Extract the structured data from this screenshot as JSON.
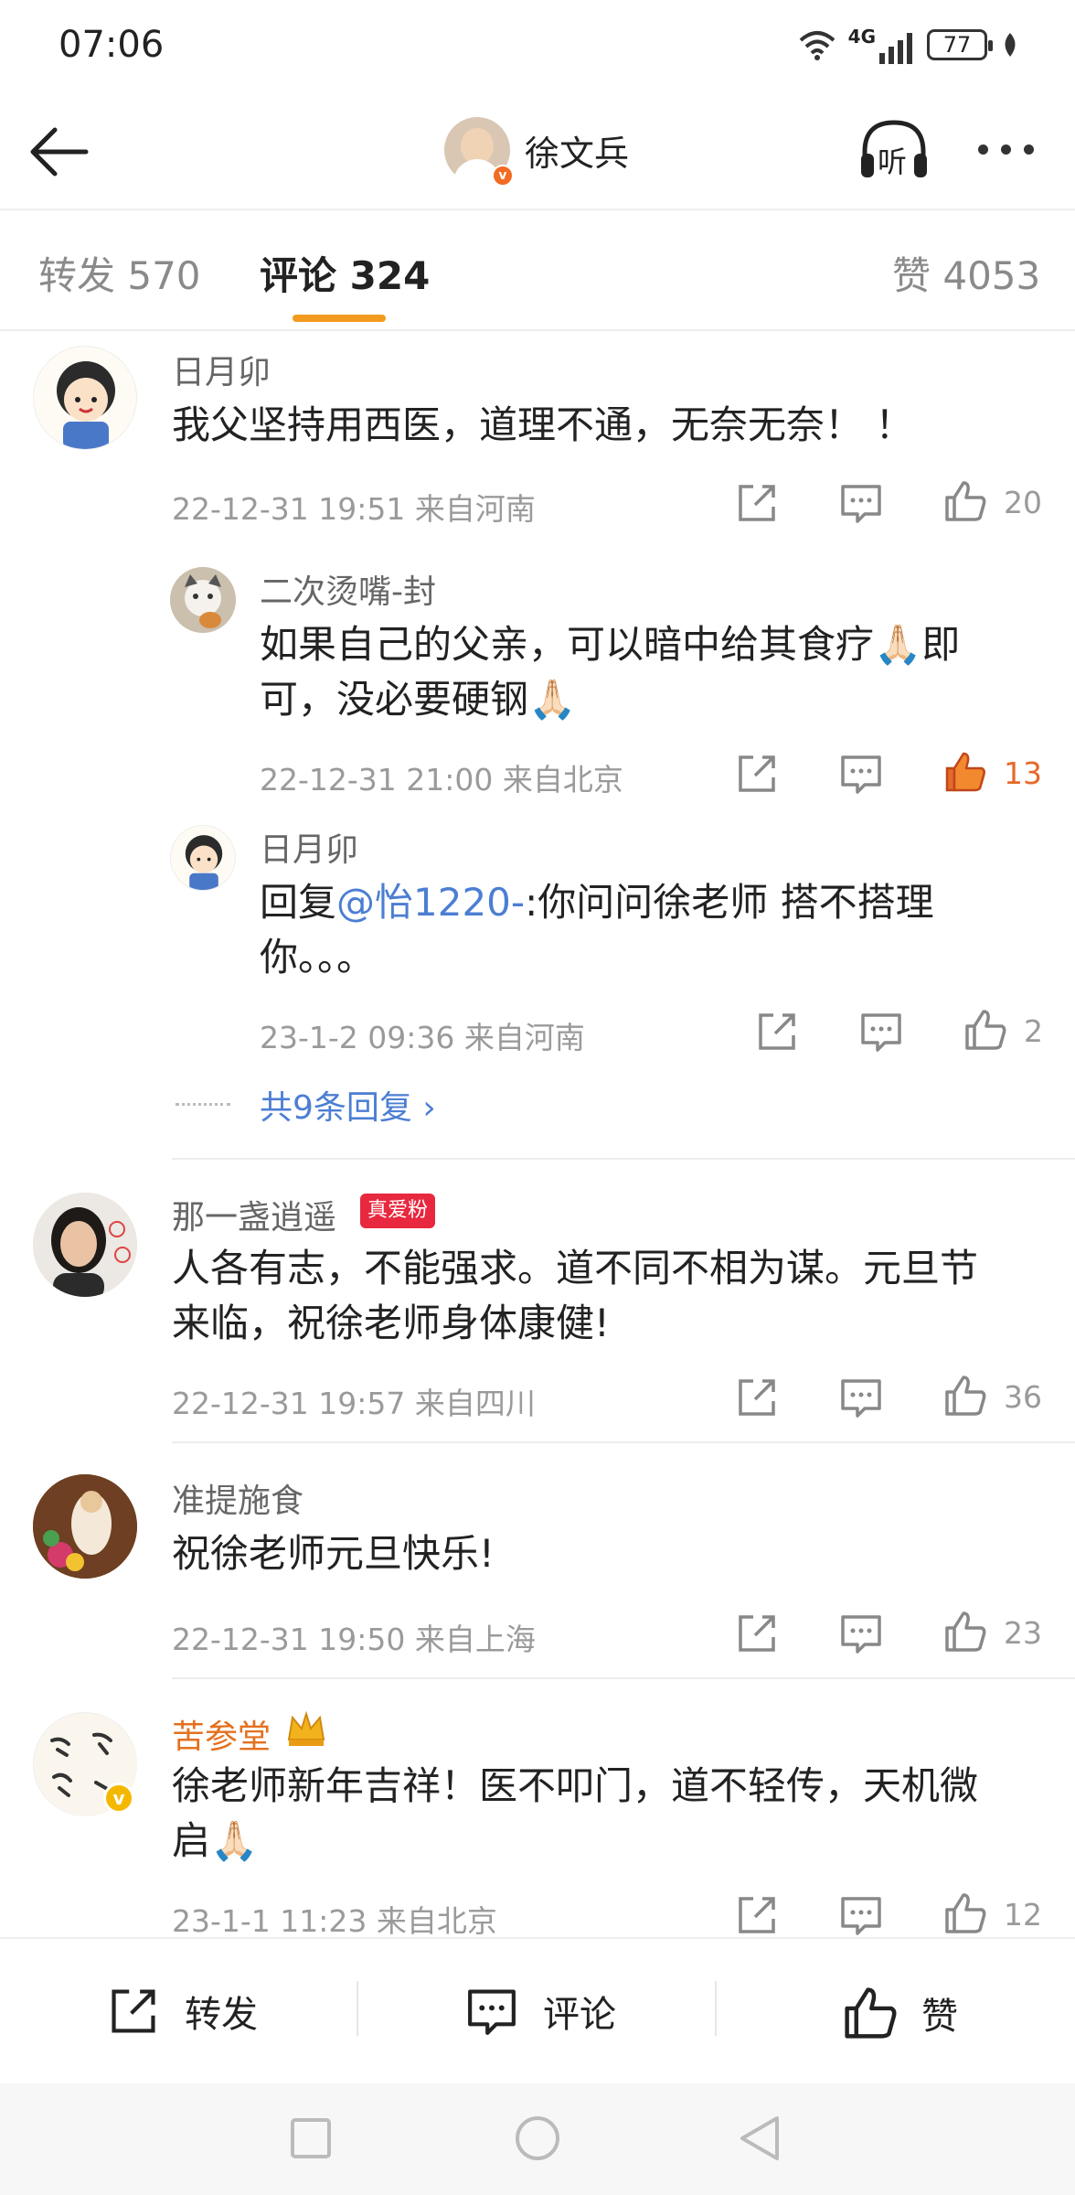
{
  "status": {
    "time": "07:06",
    "network": "4G",
    "battery": "77"
  },
  "header": {
    "title": "徐文兵",
    "back_icon": "arrow-left-icon",
    "listen_label": "听",
    "more_icon": "ellipsis-icon"
  },
  "tabs": [
    {
      "label": "转发 570"
    },
    {
      "label": "评论 324"
    },
    {
      "label": "赞 4053"
    }
  ],
  "comments": [
    {
      "name": "日月卯",
      "text": "我父坚持用西医，道理不通，无奈无奈！ ！",
      "meta": "22-12-31 19:51 来自河南",
      "likes": "20",
      "replies": [
        {
          "name": "二次烫嘴-封",
          "line1": "如果自己的父亲，可以暗中给其食疗🙏🏻即",
          "line2": "可，没必要硬钢🙏🏻",
          "meta": "22-12-31 21:00 来自北京",
          "likes": "13"
        },
        {
          "name": "日月卯",
          "prefix": "回复",
          "mention": "@怡1220-",
          "line1_rest": ":你问问徐老师 搭不搭理",
          "line2": "你。。。",
          "meta": "23-1-2 09:36 来自河南",
          "likes": "2"
        }
      ],
      "more_replies": "共9条回复 ›"
    },
    {
      "name": "那一盏逍遥",
      "badge": "真爱粉",
      "line1": "人各有志，不能强求。道不同不相为谋。元旦节",
      "line2": "来临，祝徐老师身体康健!",
      "meta": "22-12-31 19:57 来自四川",
      "likes": "36"
    },
    {
      "name": "准提施食",
      "text": "祝徐老师元旦快乐!",
      "meta": "22-12-31 19:50 来自上海",
      "likes": "23"
    },
    {
      "name": "苦参堂",
      "line1": "徐老师新年吉祥！医不叩门，道不轻传，天机微",
      "line2": "启🙏🏻",
      "meta": "23-1-1 11:23 来自北京",
      "likes": "12"
    }
  ],
  "bottom_bar": {
    "repost": "转发",
    "comment": "评论",
    "like": "赞"
  },
  "colors": {
    "accent": "#f29b1f",
    "link": "#4c7ed3",
    "liked": "#e46a2a",
    "fan_badge": "#e8283f",
    "name_vip": "#e4701e"
  }
}
